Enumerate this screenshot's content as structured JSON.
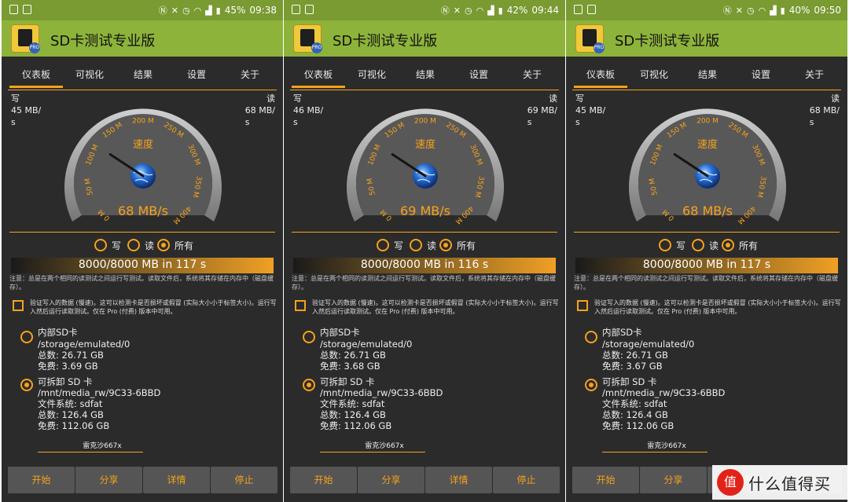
{
  "app_title": "SD卡测试专业版",
  "tabs": [
    "仪表板",
    "可视化",
    "结果",
    "设置",
    "关于"
  ],
  "labels": {
    "write": "写",
    "read": "读",
    "speed": "速度",
    "opt_write": "写",
    "opt_read": "读",
    "opt_all": "所有",
    "note": "注意：总是在两个相同的读测试之间运行写测试。读取文件后，系统将其存储在内存中（磁盘缓存）。",
    "verify": "验证写入的数据 (慢速)。这可以检测卡是否损坏或假冒 (实际大小小于标签大小)。运行写入然后运行读取测试。仅在 Pro (付费) 版本中可用。",
    "internal_title": "内部SD卡",
    "internal_path": "/storage/emulated/0",
    "removable_title": "可拆卸 SD 卡",
    "removable_path": "/mnt/media_rw/9C33-6BBD",
    "fs": "文件系统: sdfat",
    "removable_total": "总数: 126.4 GB",
    "removable_free": "免费: 112.06 GB",
    "watermark": "雷克沙667x"
  },
  "gauge_ticks": [
    "0 M",
    "50 M",
    "100 M",
    "150 M",
    "200 M",
    "250 M",
    "300 M",
    "350 M",
    "400 M"
  ],
  "buttons": [
    "开始",
    "分享",
    "详情",
    "停止"
  ],
  "screens": [
    {
      "battery": "45%",
      "time": "09:38",
      "write_speed_a": "45 MB/",
      "write_speed_b": "s",
      "read_speed_a": "68 MB/",
      "read_speed_b": "s",
      "gauge_value": "68 MB/s",
      "needle_fraction": 0.29,
      "progress_text": "8000/8000 MB in 117 s",
      "internal_total": "总数: 26.71 GB",
      "internal_free": "免费: 3.69 GB"
    },
    {
      "battery": "42%",
      "time": "09:44",
      "write_speed_a": "46 MB/",
      "write_speed_b": "s",
      "read_speed_a": "69 MB/",
      "read_speed_b": "s",
      "gauge_value": "69 MB/s",
      "needle_fraction": 0.29,
      "progress_text": "8000/8000 MB in 116 s",
      "internal_total": "总数: 26.71 GB",
      "internal_free": "免费: 3.68 GB"
    },
    {
      "battery": "40%",
      "time": "09:50",
      "write_speed_a": "45 MB/",
      "write_speed_b": "s",
      "read_speed_a": "68 MB/",
      "read_speed_b": "s",
      "gauge_value": "68 MB/s",
      "needle_fraction": 0.29,
      "progress_text": "8000/8000 MB in 117 s",
      "internal_total": "总数: 26.71 GB",
      "internal_free": "免费: 3.67 GB"
    }
  ],
  "logo": {
    "mark": "值",
    "text": "什么值得买"
  },
  "colors": {
    "accent": "#f7a21b",
    "titlebar": "#8db33a",
    "statusbar": "#7a9a32",
    "panel": "#2b2b2b",
    "button": "#555555"
  }
}
